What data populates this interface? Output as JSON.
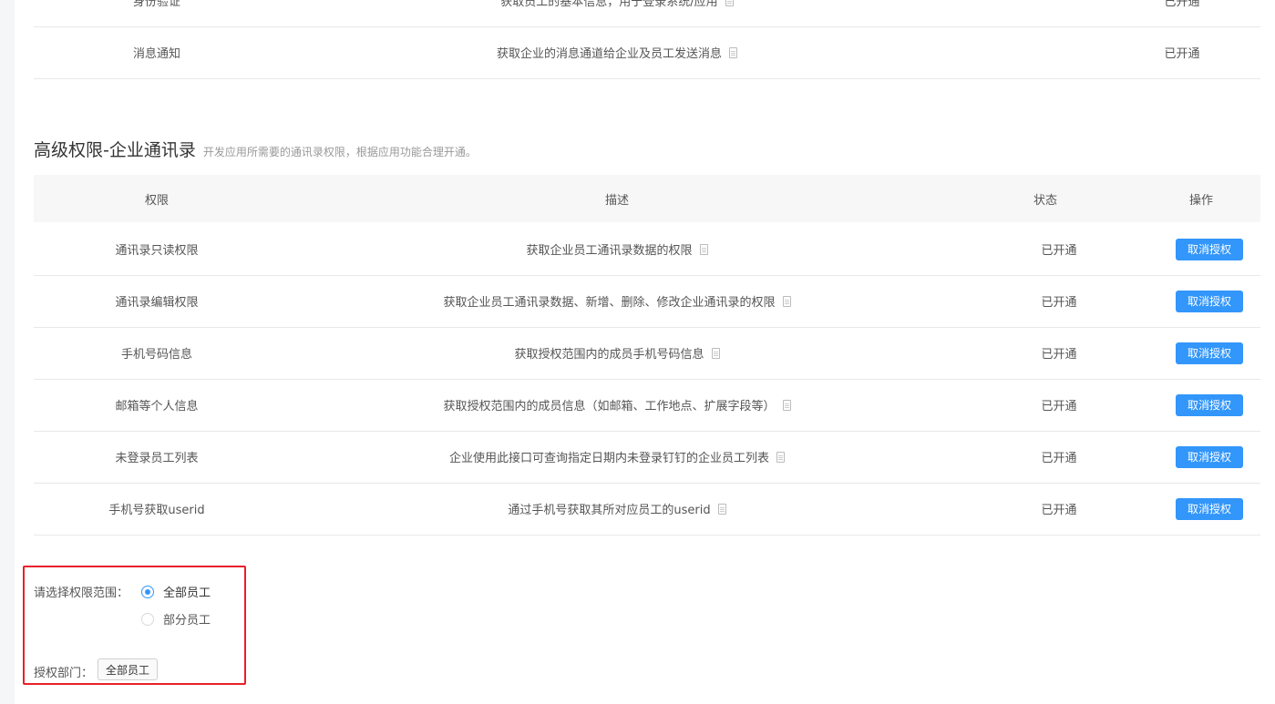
{
  "basic_rows": [
    {
      "permission": "身份验证",
      "description": "获取员工的基本信息，用于登录系统/应用",
      "status": "已开通"
    },
    {
      "permission": "消息通知",
      "description": "获取企业的消息通道给企业及员工发送消息",
      "status": "已开通"
    }
  ],
  "advanced": {
    "title": "高级权限-企业通讯录",
    "subtitle": "开发应用所需要的通讯录权限，根据应用功能合理开通。",
    "headers": {
      "permission": "权限",
      "description": "描述",
      "status": "状态",
      "operation": "操作"
    },
    "rows": [
      {
        "permission": "通讯录只读权限",
        "description": "获取企业员工通讯录数据的权限",
        "status": "已开通",
        "action": "取消授权"
      },
      {
        "permission": "通讯录编辑权限",
        "description": "获取企业员工通讯录数据、新增、删除、修改企业通讯录的权限",
        "status": "已开通",
        "action": "取消授权"
      },
      {
        "permission": "手机号码信息",
        "description": "获取授权范围内的成员手机号码信息",
        "status": "已开通",
        "action": "取消授权"
      },
      {
        "permission": "邮箱等个人信息",
        "description": "获取授权范围内的成员信息（如邮箱、工作地点、扩展字段等）",
        "status": "已开通",
        "action": "取消授权"
      },
      {
        "permission": "未登录员工列表",
        "description": "企业使用此接口可查询指定日期内未登录钉钉的企业员工列表",
        "status": "已开通",
        "action": "取消授权"
      },
      {
        "permission": "手机号获取userid",
        "description": "通过手机号获取其所对应员工的userid",
        "status": "已开通",
        "action": "取消授权"
      }
    ]
  },
  "scope": {
    "label": "请选择权限范围：",
    "options": [
      {
        "label": "全部员工",
        "selected": true
      },
      {
        "label": "部分员工",
        "selected": false
      }
    ],
    "dept_label": "授权部门：",
    "dept_value": "全部员工"
  },
  "colors": {
    "accent": "#3296fa",
    "highlight_border": "#e8202a"
  }
}
